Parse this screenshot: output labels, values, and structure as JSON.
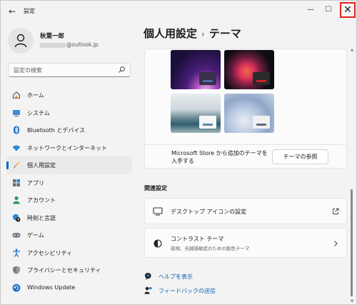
{
  "window": {
    "title": "設定",
    "back_icon": "arrow-left-icon",
    "minimize_icon": "minimize-icon",
    "maximize_icon": "maximize-icon",
    "close_icon": "close-icon",
    "back_glyph": "←",
    "minimize_glyph": "—",
    "maximize_glyph": "☐",
    "close_glyph": "✕",
    "close_highlight_color": "#e0231c"
  },
  "profile": {
    "name": "秋葉一郎",
    "email_suffix": "@outlook.jp"
  },
  "search": {
    "placeholder": "設定の検索"
  },
  "sidebar": {
    "items": [
      {
        "label": "ホーム",
        "icon": "home-icon",
        "active": false
      },
      {
        "label": "システム",
        "icon": "system-icon",
        "active": false
      },
      {
        "label": "Bluetooth とデバイス",
        "icon": "bluetooth-icon",
        "active": false
      },
      {
        "label": "ネットワークとインターネット",
        "icon": "wifi-icon",
        "active": false
      },
      {
        "label": "個人用設定",
        "icon": "personalization-icon",
        "active": true
      },
      {
        "label": "アプリ",
        "icon": "apps-icon",
        "active": false
      },
      {
        "label": "アカウント",
        "icon": "account-icon",
        "active": false
      },
      {
        "label": "時刻と言語",
        "icon": "time-language-icon",
        "active": false
      },
      {
        "label": "ゲーム",
        "icon": "gaming-icon",
        "active": false
      },
      {
        "label": "アクセシビリティ",
        "icon": "accessibility-icon",
        "active": false
      },
      {
        "label": "プライバシーとセキュリティ",
        "icon": "shield-icon",
        "active": false
      },
      {
        "label": "Windows Update",
        "icon": "windows-update-icon",
        "active": false
      }
    ]
  },
  "main": {
    "breadcrumb_parent": "個人用設定",
    "breadcrumb_separator": "›",
    "breadcrumb_current": "テーマ",
    "store_text": "Microsoft Store から追加のテーマを入手する",
    "browse_button": "テーマの参照",
    "related_title": "関連設定",
    "desktop_icons_label": "デスクトップ アイコンの設定",
    "contrast_label": "コントラスト テーマ",
    "contrast_sub": "弱視、光線過敏症のための配色テーマ",
    "help_link": "ヘルプを表示",
    "feedback_link": "フィードバックの送信"
  },
  "colors": {
    "accent": "#0067c0",
    "link": "#0a5fb3"
  }
}
